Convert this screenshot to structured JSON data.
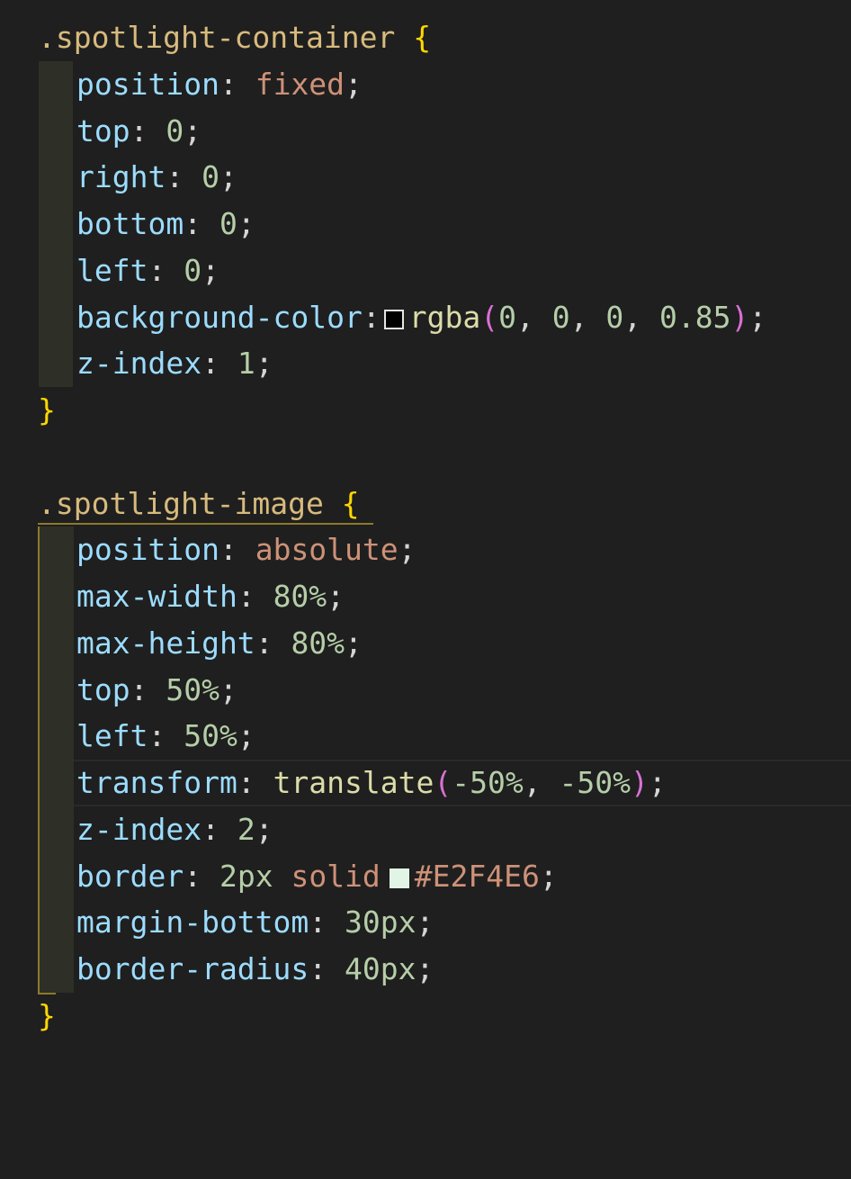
{
  "rules": [
    {
      "selector": ".spotlight-container",
      "open": "{",
      "close": "}",
      "declarations": [
        {
          "prop": "position",
          "value": "fixed"
        },
        {
          "prop": "top",
          "value": "0"
        },
        {
          "prop": "right",
          "value": "0"
        },
        {
          "prop": "bottom",
          "value": "0"
        },
        {
          "prop": "left",
          "value": "0"
        },
        {
          "prop": "background-color",
          "fn": "rgba",
          "args": [
            "0",
            "0",
            "0",
            "0.85"
          ],
          "swatch": "#000000"
        },
        {
          "prop": "z-index",
          "value": "1"
        }
      ]
    },
    {
      "selector": ".spotlight-image",
      "open": "{",
      "close": "}",
      "declarations": [
        {
          "prop": "position",
          "value": "absolute"
        },
        {
          "prop": "max-width",
          "value": "80%"
        },
        {
          "prop": "max-height",
          "value": "80%"
        },
        {
          "prop": "top",
          "value": "50%"
        },
        {
          "prop": "left",
          "value": "50%"
        },
        {
          "prop": "transform",
          "fn": "translate",
          "args": [
            "-50%",
            "-50%"
          ]
        },
        {
          "prop": "z-index",
          "value": "2"
        },
        {
          "prop": "border",
          "value_a": "2px",
          "value_b": "solid",
          "hex": "#E2F4E6",
          "swatch": "#E2F4E6"
        },
        {
          "prop": "margin-bottom",
          "value": "30px"
        },
        {
          "prop": "border-radius",
          "value": "40px"
        }
      ]
    }
  ],
  "punct": {
    "colon": ": ",
    "colon_tight": ":",
    "semi": ";",
    "comma": ", ",
    "lparen": "(",
    "rparen": ")",
    "space": " "
  }
}
